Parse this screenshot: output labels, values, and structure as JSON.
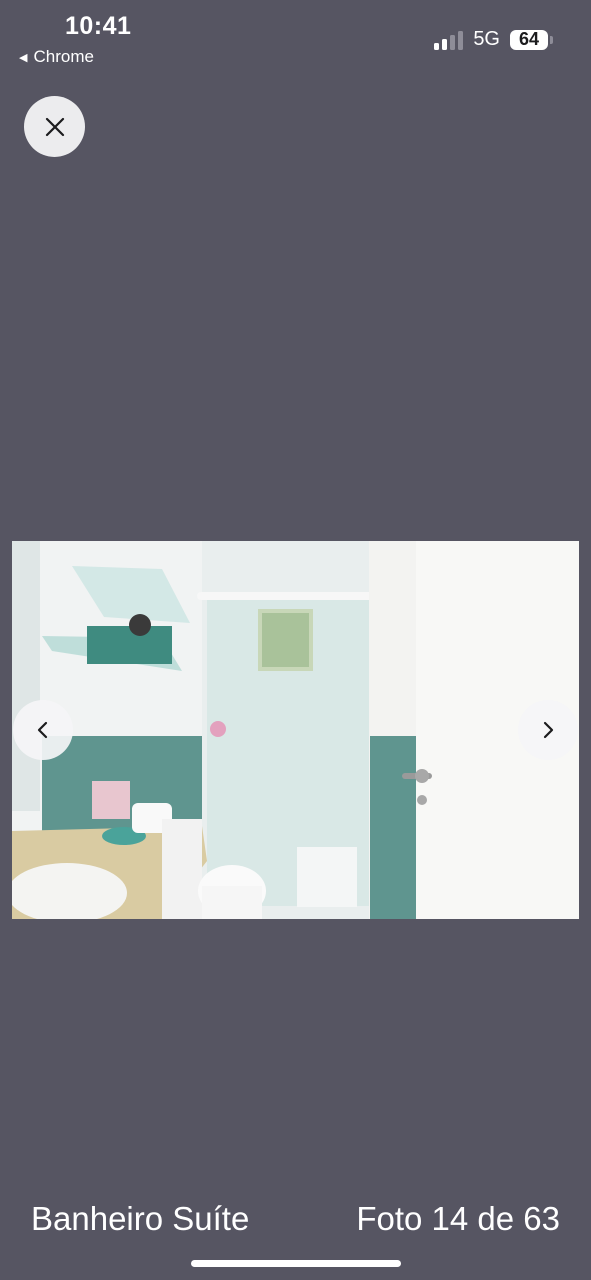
{
  "status_bar": {
    "time": "10:41",
    "back_app": "Chrome",
    "network": "5G",
    "battery": "64",
    "signal_bars_active": 2,
    "signal_bars_total": 4
  },
  "viewer": {
    "close_icon": "close-icon",
    "prev_icon": "chevron-left-icon",
    "next_icon": "chevron-right-icon",
    "caption": "Banheiro Suíte",
    "counter": "Foto 14 de 63"
  },
  "colors": {
    "background": "#565562",
    "button_bg": "#ececee",
    "text": "#ffffff"
  }
}
